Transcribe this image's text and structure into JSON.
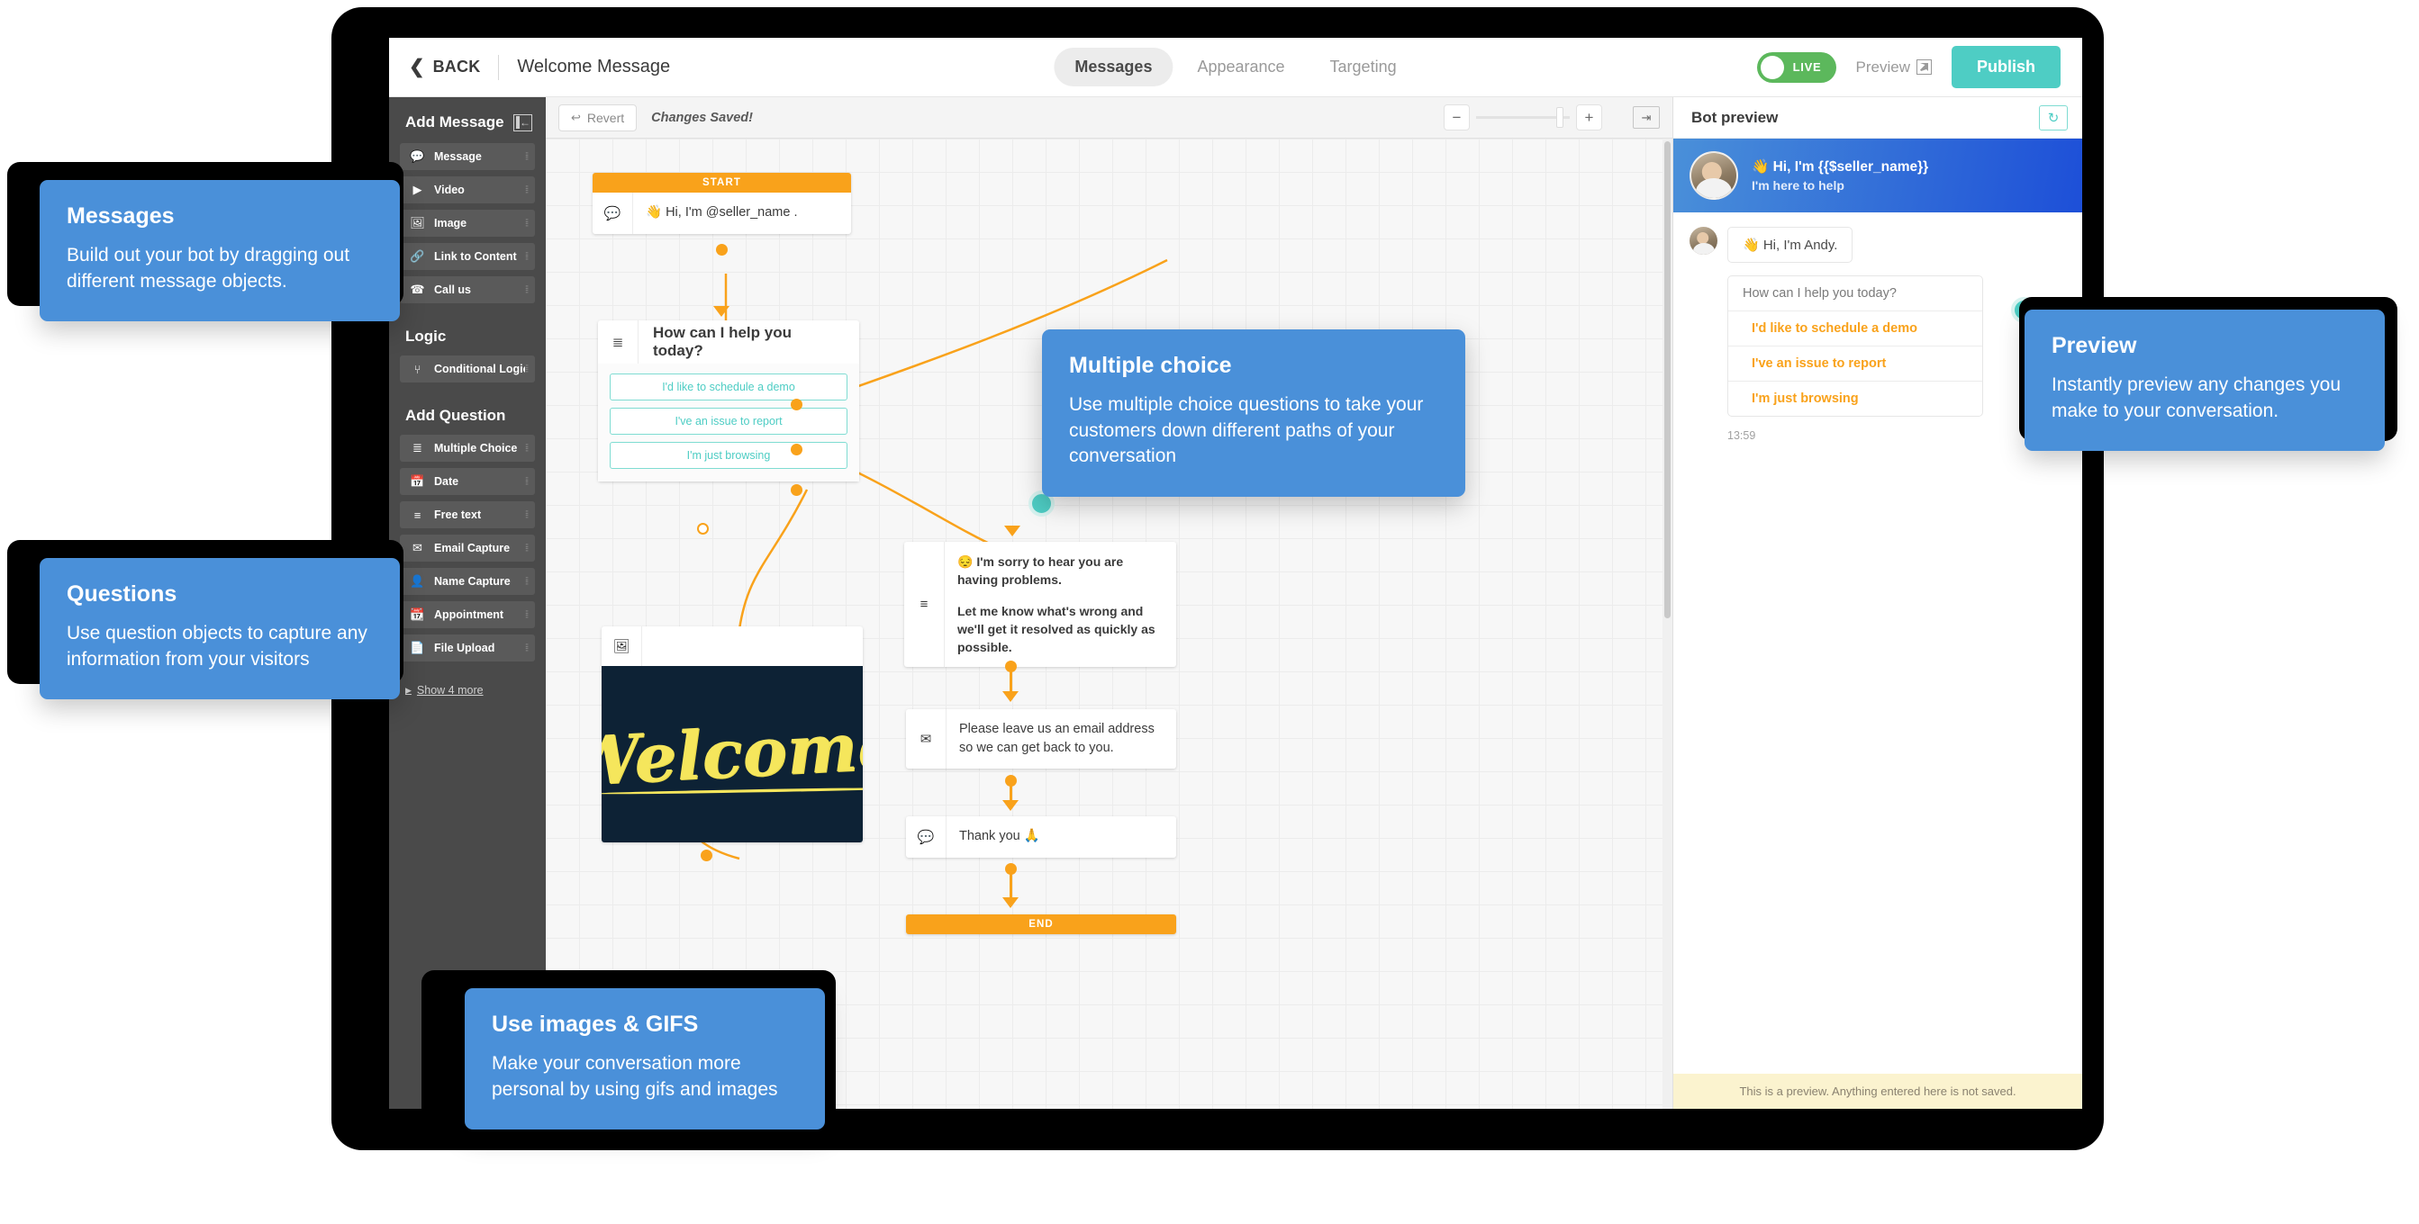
{
  "header": {
    "back_label": "BACK",
    "back_icon": "chevron-left-icon",
    "doc_title": "Welcome Message",
    "tabs": [
      {
        "label": "Messages",
        "active": true
      },
      {
        "label": "Appearance",
        "active": false
      },
      {
        "label": "Targeting",
        "active": false
      }
    ],
    "live_toggle_label": "LIVE",
    "live_toggle_on": true,
    "live_color": "#5cb85c",
    "preview_link_label": "Preview",
    "preview_link_icon": "external-link-icon",
    "publish_label": "Publish",
    "publish_color": "#4ecdc4"
  },
  "sidebar": {
    "add_message_title": "Add Message",
    "collapse_icon": "collapse-panel-icon",
    "message_items": [
      {
        "label": "Message",
        "icon": "chat-bubbles-icon"
      },
      {
        "label": "Video",
        "icon": "video-play-icon"
      },
      {
        "label": "Image",
        "icon": "image-icon"
      },
      {
        "label": "Link to Content",
        "icon": "link-icon"
      },
      {
        "label": "Call us",
        "icon": "phone-icon"
      }
    ],
    "logic_title": "Logic",
    "logic_items": [
      {
        "label": "Conditional Logic",
        "icon": "branch-icon"
      }
    ],
    "question_title": "Add Question",
    "question_items": [
      {
        "label": "Multiple Choice",
        "icon": "checklist-icon"
      },
      {
        "label": "Date",
        "icon": "calendar-check-icon"
      },
      {
        "label": "Free text",
        "icon": "text-lines-icon"
      },
      {
        "label": "Email Capture",
        "icon": "envelope-icon"
      },
      {
        "label": "Name Capture",
        "icon": "person-icon"
      },
      {
        "label": "Appointment",
        "icon": "calendar-icon"
      },
      {
        "label": "File Upload",
        "icon": "file-upload-icon"
      }
    ],
    "show_more_label": "Show 4 more",
    "show_more_caret": "caret-right-icon",
    "drag_handle": "⦙⦙"
  },
  "canvas_toolbar": {
    "revert_label": "Revert",
    "revert_icon": "undo-arrow-icon",
    "saved_text": "Changes Saved!",
    "zoom_out_label": "−",
    "zoom_in_label": "+",
    "fit_icon": "fit-to-screen-icon"
  },
  "flow": {
    "start_label": "START",
    "end_label": "END",
    "start_message": "👋 Hi, I'm @seller_name .",
    "start_icon": "chat-bubbles-icon",
    "multiple_choice": {
      "icon": "checklist-icon",
      "question": "How can I help you today?",
      "options": [
        "I'd like to schedule a demo",
        "I've an issue to report",
        "I'm just browsing"
      ]
    },
    "image_node": {
      "icon": "image-icon",
      "image_caption": "Welcome"
    },
    "sorry_node": {
      "icon": "text-lines-icon",
      "line1": "😔 I'm sorry to hear you are having problems.",
      "line2": "Let me know what's wrong and we'll get it resolved as quickly as possible."
    },
    "email_node": {
      "icon": "envelope-icon",
      "text": "Please leave us an email address so we can get back to you."
    },
    "thankyou_node": {
      "icon": "chat-bubbles-icon",
      "text": "Thank you 🙏"
    }
  },
  "bot_preview": {
    "title": "Bot preview",
    "refresh_icon": "refresh-icon",
    "bot_greeting": "👋 Hi, I'm {{$seller_name}}",
    "bot_subtitle": "I'm here to help",
    "avatar": "user-avatar",
    "chat_message": "👋 Hi, I'm Andy.",
    "choice_question": "How can I help you today?",
    "choices": [
      "I'd like to schedule a demo",
      "I've an issue to report",
      "I'm just browsing"
    ],
    "timestamp": "13:59",
    "footer_note": "This is a preview. Anything entered here is not saved."
  },
  "callouts": [
    {
      "id": "messages",
      "title": "Messages",
      "body": "Build out your bot by dragging out different message objects."
    },
    {
      "id": "questions",
      "title": "Questions",
      "body": "Use question objects to capture any information from your visitors"
    },
    {
      "id": "multiple-choice",
      "title": "Multiple choice",
      "body": "Use multiple choice questions to take your customers down different paths of your conversation"
    },
    {
      "id": "preview",
      "title": "Preview",
      "body": "Instantly preview any changes you make to your conversation."
    },
    {
      "id": "images-gifs",
      "title": "Use images & GIFS",
      "body": "Make your conversation more personal by using gifs and images"
    }
  ]
}
